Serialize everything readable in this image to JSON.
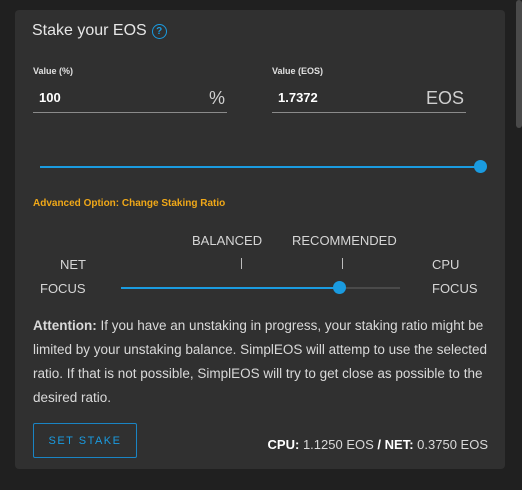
{
  "card": {
    "title": "Stake your EOS",
    "help_icon": "question-circle-icon"
  },
  "value_percent": {
    "label": "Value (%)",
    "value": "100",
    "unit": "%"
  },
  "value_eos": {
    "label": "Value (EOS)",
    "value": "1.7372",
    "unit": "EOS"
  },
  "stake_slider": {
    "level_fraction": 1.0
  },
  "advanced": {
    "label": "Advanced Option: Change Staking Ratio"
  },
  "ratio": {
    "balanced_label": "BALANCED",
    "recommended_label": "RECOMMENDED",
    "net_label": "NET",
    "net_focus_label": "FOCUS",
    "cpu_label": "CPU",
    "cpu_focus_label": "FOCUS",
    "tick_mark": "|",
    "level_fraction": 0.78
  },
  "attention": {
    "heading": "Attention:",
    "text": "If you have an unstaking in progress, your staking ratio might be limited by your unstaking balance. SimplEOS will attemp to use the selected ratio. If that is not possible, SimplEOS will try to get close as possible to the desired ratio."
  },
  "actions": {
    "set_stake_label": "SET STAKE"
  },
  "summary": {
    "cpu_label": "CPU:",
    "cpu_value": "1.1250 EOS",
    "separator": "/",
    "net_label": "NET:",
    "net_value": "0.3750 EOS"
  },
  "colors": {
    "accent": "#1a9be0",
    "warning": "#f0a818",
    "card_bg": "#303030",
    "page_bg": "#202020"
  }
}
